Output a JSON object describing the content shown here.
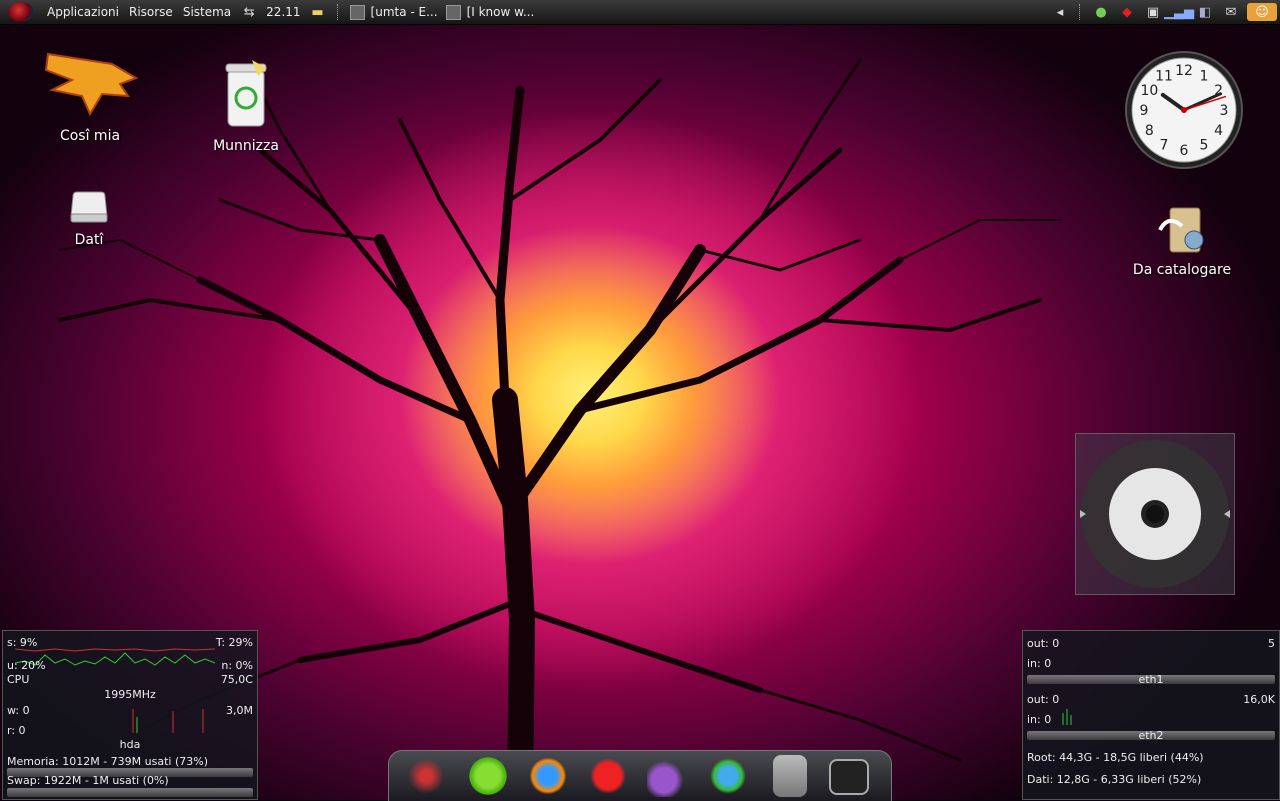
{
  "top_panel": {
    "menus": [
      "Applicazioni",
      "Risorse",
      "Sistema"
    ],
    "clock": "22.11",
    "tasks": [
      "[umta - E...",
      "[I know w..."
    ]
  },
  "desktop_icons": [
    {
      "label": "Cosî mia",
      "icon": "umta-eagle-logo"
    },
    {
      "label": "Munnizza",
      "icon": "trash-icon"
    },
    {
      "label": "Datî",
      "icon": "drive-icon"
    },
    {
      "label": "Da catalogare",
      "icon": "folder-icon"
    }
  ],
  "clock_widget": {
    "hour": 10,
    "minute": 11,
    "second": 12
  },
  "conky_left": {
    "cpu_s": "s: 9%",
    "cpu_t": "T: 29%",
    "cpu_u": "u: 20%",
    "cpu_n": "n: 0%",
    "cpu_label": "CPU",
    "cpu_temp": "75,0C",
    "cpu_freq": "1995MHz",
    "disk_w": "w: 0",
    "disk_rate": "3,0M",
    "disk_r": "r: 0",
    "disk_label": "hda",
    "memory": "Memoria: 1012M - 739M usati (73%)",
    "swap": "Swap: 1922M - 1M usati (0%)"
  },
  "conky_right": {
    "eth1_out": "out: 0",
    "eth1_val": "5",
    "eth1_in": "in: 0",
    "eth1_label": "eth1",
    "eth2_out": "out: 0",
    "eth2_val": "16,0K",
    "eth2_in": "in: 0",
    "eth2_label": "eth2",
    "root": "Root: 44,3G - 18,5G liberi (44%)",
    "dati": "Dati: 12,8G - 6,33G liberi (52%)"
  },
  "dock_items": [
    "quake-icon",
    "play-icon",
    "browser-icon",
    "skype-icon",
    "pidgin-icon",
    "messenger-icon",
    "file-cabinet-icon",
    "terminal-icon"
  ],
  "colors": {
    "panel": "#2a2a2a",
    "accent": "#d8106a"
  }
}
